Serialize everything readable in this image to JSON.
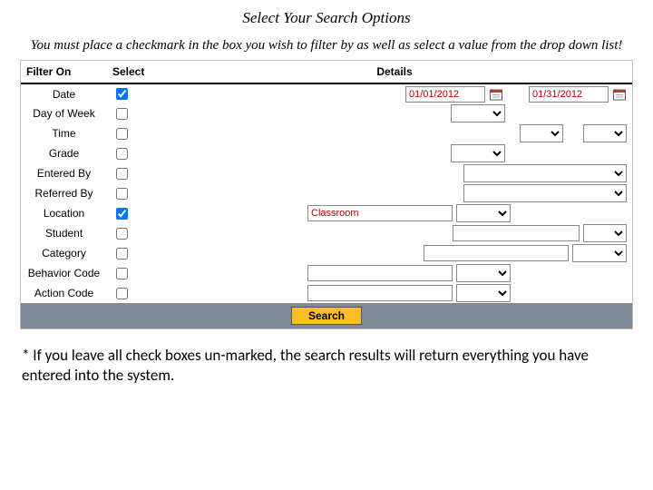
{
  "heading": "Select Your Search Options",
  "subtitle": "You must place a checkmark in the box you wish to filter by as well as select a value from the drop down list!",
  "columns": {
    "filter": "Filter On",
    "select": "Select",
    "details": "Details"
  },
  "rows": {
    "date": {
      "label": "Date",
      "checked": true,
      "from": "01/01/2012",
      "to": "01/31/2012"
    },
    "dayOfWeek": {
      "label": "Day of Week",
      "checked": false,
      "value": ""
    },
    "time": {
      "label": "Time",
      "checked": false,
      "value1": "",
      "value2": ""
    },
    "grade": {
      "label": "Grade",
      "checked": false,
      "value": ""
    },
    "enteredBy": {
      "label": "Entered By",
      "checked": false,
      "value": ""
    },
    "referredBy": {
      "label": "Referred By",
      "checked": false,
      "value": ""
    },
    "location": {
      "label": "Location",
      "checked": true,
      "value": "Classroom"
    },
    "student": {
      "label": "Student",
      "checked": false,
      "value": ""
    },
    "category": {
      "label": "Category",
      "checked": false,
      "value": ""
    },
    "behaviorCode": {
      "label": "Behavior Code",
      "checked": false,
      "value": ""
    },
    "actionCode": {
      "label": "Action Code",
      "checked": false,
      "value": ""
    }
  },
  "searchLabel": "Search",
  "footnote": "* If you leave all check boxes un-marked, the search results will return everything you have entered into the system."
}
